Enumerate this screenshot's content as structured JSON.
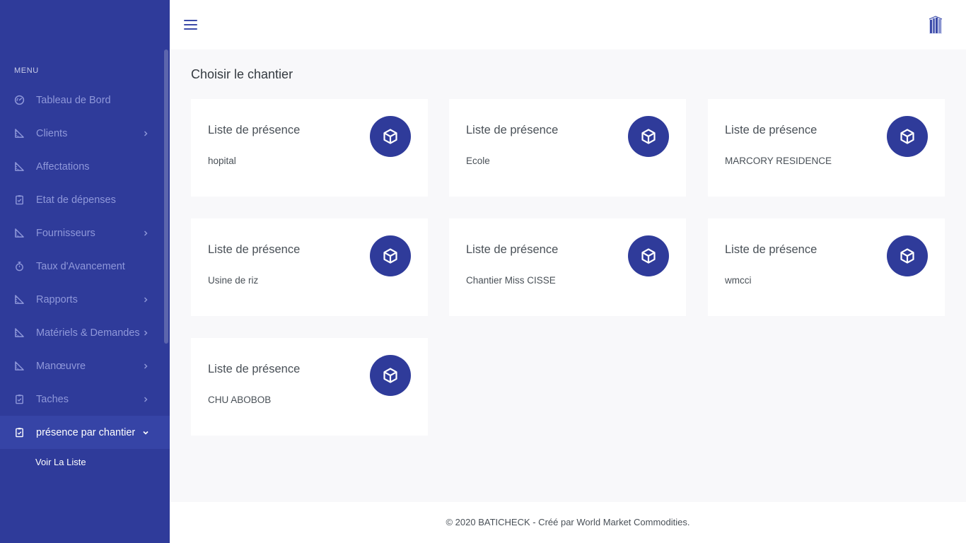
{
  "sidebar": {
    "menu_title": "MENU",
    "items": [
      {
        "label": "Tableau de Bord",
        "icon": "dashboard-icon",
        "has_chevron": false
      },
      {
        "label": "Clients",
        "icon": "ruler-icon",
        "has_chevron": true
      },
      {
        "label": "Affectations",
        "icon": "ruler-icon",
        "has_chevron": false
      },
      {
        "label": "Etat de dépenses",
        "icon": "clipboard-icon",
        "has_chevron": false
      },
      {
        "label": "Fournisseurs",
        "icon": "ruler-icon",
        "has_chevron": true
      },
      {
        "label": "Taux d'Avancement",
        "icon": "timer-icon",
        "has_chevron": false
      },
      {
        "label": "Rapports",
        "icon": "ruler-icon",
        "has_chevron": true
      },
      {
        "label": "Matériels & Demandes",
        "icon": "ruler-icon",
        "has_chevron": true
      },
      {
        "label": "Manœuvre",
        "icon": "ruler-icon",
        "has_chevron": true
      },
      {
        "label": "Taches",
        "icon": "clipboard-icon",
        "has_chevron": true
      },
      {
        "label": "présence par chantier",
        "icon": "clipboard-icon",
        "has_chevron": true,
        "active": true
      }
    ],
    "submenu": [
      {
        "label": "Voir La Liste"
      }
    ]
  },
  "main": {
    "title": "Choisir le chantier",
    "cards": [
      {
        "title": "Liste de présence",
        "subtitle": "hopital",
        "icon": "cube-icon"
      },
      {
        "title": "Liste de présence",
        "subtitle": "Ecole",
        "icon": "cube-icon"
      },
      {
        "title": "Liste de présence",
        "subtitle": "MARCORY RESIDENCE",
        "icon": "cube-icon"
      },
      {
        "title": "Liste de présence",
        "subtitle": "Usine de riz",
        "icon": "cube-icon"
      },
      {
        "title": "Liste de présence",
        "subtitle": "Chantier Miss CISSE",
        "icon": "cube-icon"
      },
      {
        "title": "Liste de présence",
        "subtitle": "wmcci",
        "icon": "cube-icon"
      },
      {
        "title": "Liste de présence",
        "subtitle": "CHU ABOBOB",
        "icon": "cube-icon"
      }
    ]
  },
  "footer": {
    "text": "© 2020 BATICHECK - Créé par World Market Commodities."
  },
  "colors": {
    "sidebar_bg": "#2f3b9a",
    "accent": "#2f3b9a",
    "nav_text": "#8f98da",
    "page_bg": "#f8f8fa"
  }
}
